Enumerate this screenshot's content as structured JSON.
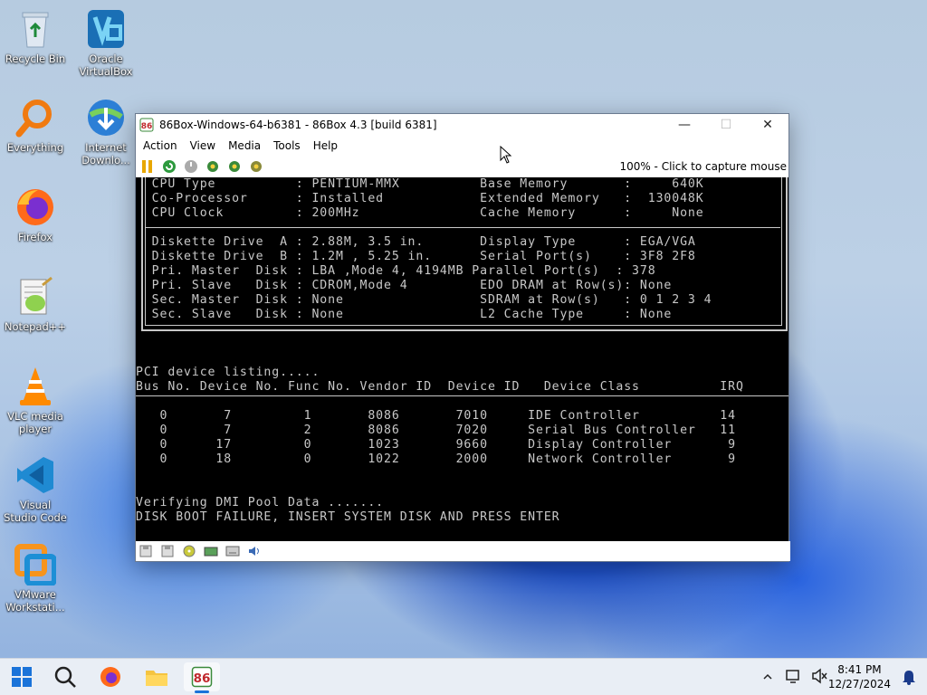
{
  "desktop": {
    "icons": [
      {
        "label": "Recycle Bin"
      },
      {
        "label": "Oracle VirtualBox"
      },
      {
        "label": "Everything"
      },
      {
        "label": "Internet Downlo..."
      },
      {
        "label": "Firefox"
      },
      {
        "label": "Notepad++"
      },
      {
        "label": "VLC media player"
      },
      {
        "label": "Visual Studio Code"
      },
      {
        "label": "VMware Workstati..."
      }
    ]
  },
  "window": {
    "title": "86Box-Windows-64-b6381 - 86Box 4.3 [build 6381]",
    "menu": [
      "Action",
      "View",
      "Media",
      "Tools",
      "Help"
    ],
    "capture_hint": "100% - Click to capture mouse",
    "toolbar_icons": [
      "pause-icon",
      "reset-icon",
      "power-icon",
      "settings-icon",
      "settings-2-icon",
      "screenshot-icon"
    ],
    "statusbar_icons": [
      "floppy-a-icon",
      "floppy-b-icon",
      "cdrom-icon",
      "hdd-icon",
      "network-icon",
      "sound-icon"
    ]
  },
  "bios": {
    "sys_lines": [
      "  CPU Type          : PENTIUM-MMX          Base Memory       :     640K",
      "  Co-Processor      : Installed            Extended Memory   :  130048K",
      "  CPU Clock         : 200MHz               Cache Memory      :     None"
    ],
    "dev_lines": [
      "  Diskette Drive  A : 2.88M, 3.5 in.       Display Type      : EGA/VGA",
      "  Diskette Drive  B : 1.2M , 5.25 in.      Serial Port(s)    : 3F8 2F8",
      "  Pri. Master  Disk : LBA ,Mode 4, 4194MB Parallel Port(s)  : 378",
      "  Pri. Slave   Disk : CDROM,Mode 4         EDO DRAM at Row(s): None",
      "  Sec. Master  Disk : None                 SDRAM at Row(s)   : 0 1 2 3 4",
      "  Sec. Slave   Disk : None                 L2 Cache Type     : None"
    ],
    "pci_title": "PCI device listing.....",
    "pci_header": "Bus No. Device No. Func No. Vendor ID  Device ID   Device Class          IRQ",
    "pci_rows": [
      "   0       7         1       8086       7010     IDE Controller          14",
      "   0       7         2       8086       7020     Serial Bus Controller   11",
      "   0      17         0       1023       9660     Display Controller       9",
      "   0      18         0       1022       2000     Network Controller       9"
    ],
    "dmi": "Verifying DMI Pool Data .......",
    "error": "DISK BOOT FAILURE, INSERT SYSTEM DISK AND PRESS ENTER"
  },
  "taskbar": {
    "time": "8:41 PM",
    "date": "12/27/2024"
  }
}
